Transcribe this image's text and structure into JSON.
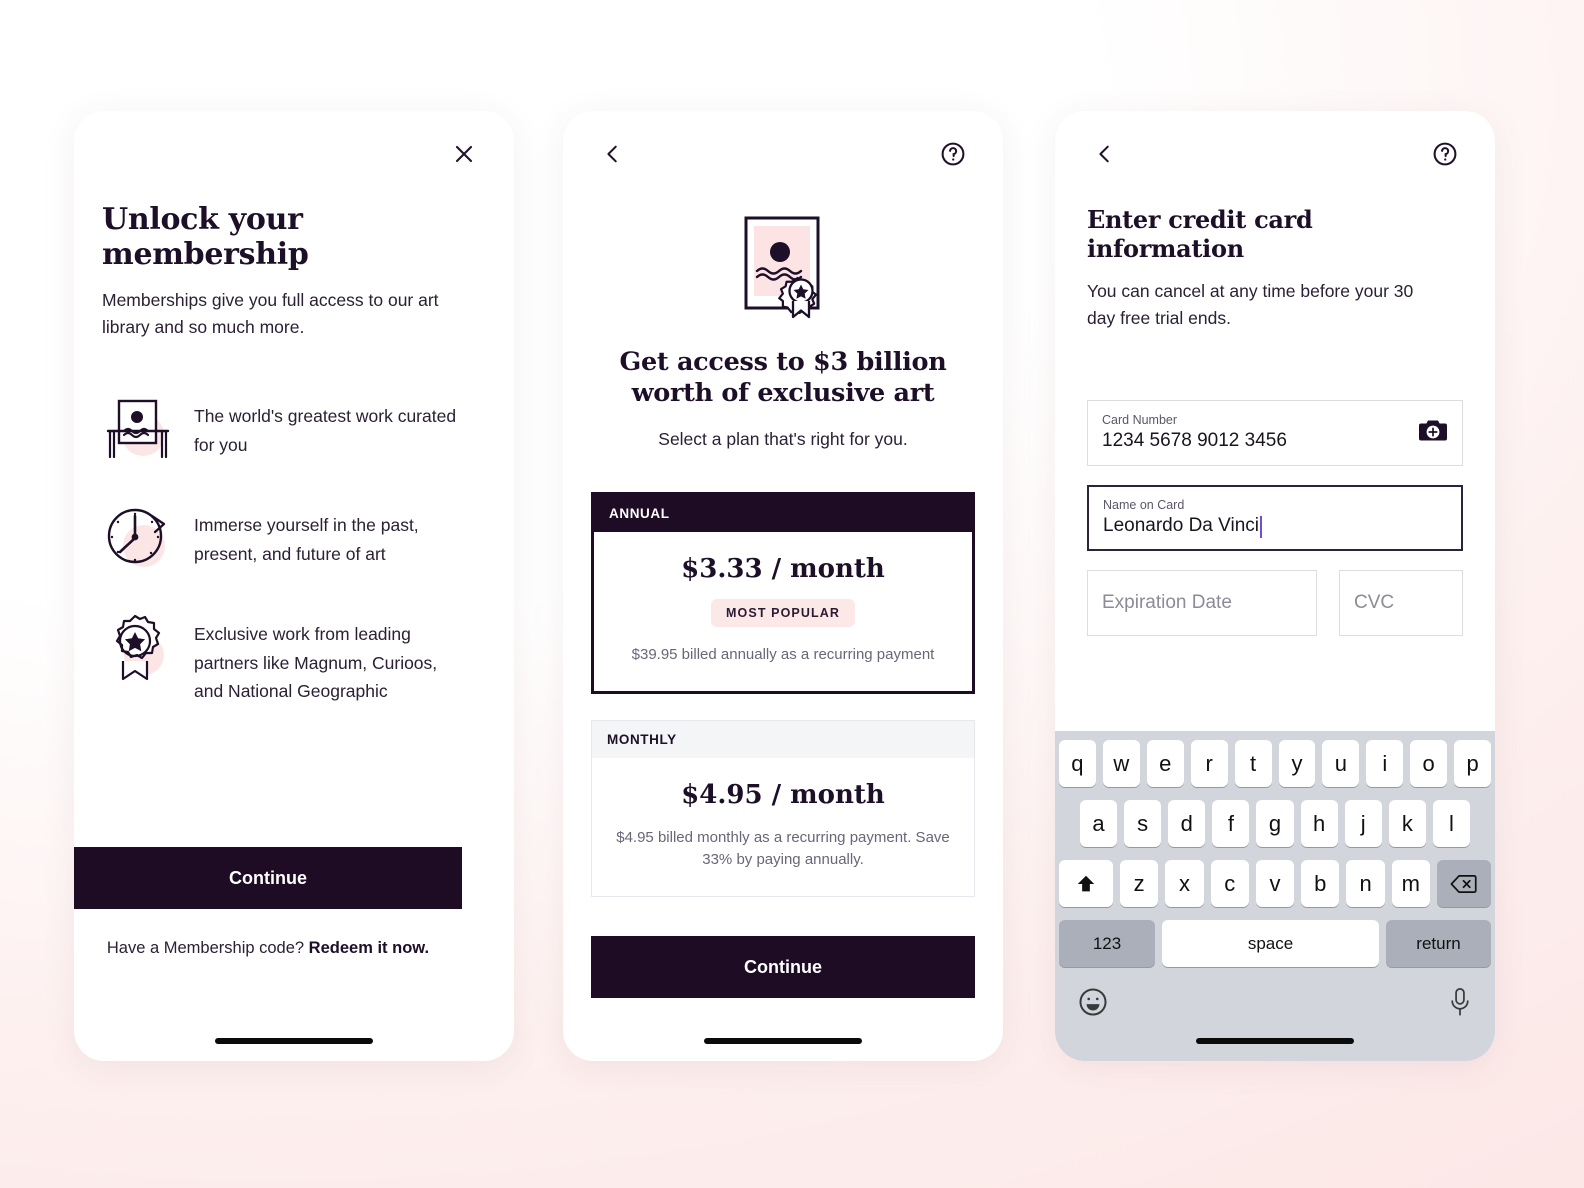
{
  "screen1": {
    "close_icon": "close-icon",
    "title": "Unlock your membership",
    "subtitle": "Memberships give you full access to our art library and so much more.",
    "features": [
      {
        "icon": "framed-artwork-icon",
        "text": "The world's greatest work curated for you"
      },
      {
        "icon": "clock-icon",
        "text": "Immerse yourself in the past, present, and future of art"
      },
      {
        "icon": "award-ribbon-icon",
        "text": "Exclusive work from leading partners like Magnum, Curioos, and National Geographic"
      }
    ],
    "cta_label": "Continue",
    "redeem_prefix": "Have a Membership code? ",
    "redeem_link": "Redeem it now."
  },
  "screen2": {
    "back_icon": "back-chevron-icon",
    "help_icon": "help-circle-icon",
    "hero_icon": "certified-artwork-icon",
    "title": "Get access to $3 billion worth of exclusive art",
    "subtitle": "Select a plan that's right for you.",
    "plans": [
      {
        "id": "annual",
        "label": "ANNUAL",
        "price": "$3.33 / month",
        "badge": "MOST POPULAR",
        "note": "$39.95 billed annually as a recurring payment",
        "selected": true
      },
      {
        "id": "monthly",
        "label": "MONTHLY",
        "price": "$4.95 / month",
        "badge": "",
        "note": "$4.95 billed monthly as a recurring payment. Save 33% by paying annually.",
        "selected": false
      }
    ],
    "cta_label": "Continue"
  },
  "screen3": {
    "back_icon": "back-chevron-icon",
    "help_icon": "help-circle-icon",
    "title": "Enter credit card information",
    "subtitle": "You can cancel at any time before your 30 day free trial ends.",
    "fields": {
      "card_number": {
        "label": "Card Number",
        "value": "1234 5678 9012 3456",
        "scan_icon": "camera-add-icon"
      },
      "name_on_card": {
        "label": "Name on Card",
        "value": "Leonardo Da Vinci",
        "focused": true
      },
      "expiration": {
        "placeholder": "Expiration Date",
        "value": ""
      },
      "cvc": {
        "placeholder": "CVC",
        "value": ""
      }
    }
  },
  "keyboard": {
    "row1": [
      "q",
      "w",
      "e",
      "r",
      "t",
      "y",
      "u",
      "i",
      "o",
      "p"
    ],
    "row2": [
      "a",
      "s",
      "d",
      "f",
      "g",
      "h",
      "j",
      "k",
      "l"
    ],
    "row3_letters": [
      "z",
      "x",
      "c",
      "v",
      "b",
      "n",
      "m"
    ],
    "shift_icon": "shift-up-arrow-icon",
    "backspace_icon": "backspace-delete-icon",
    "numbers_key": "123",
    "space_key": "space",
    "return_key": "return",
    "emoji_icon": "emoji-smiley-icon",
    "mic_icon": "microphone-icon"
  },
  "colors": {
    "ink": "#1d0c24",
    "accent_pink": "#fbe8e7",
    "background_pink": "#fbe3e2",
    "caret_purple": "#6e4fd1",
    "keyboard_gray": "#d2d5db"
  }
}
